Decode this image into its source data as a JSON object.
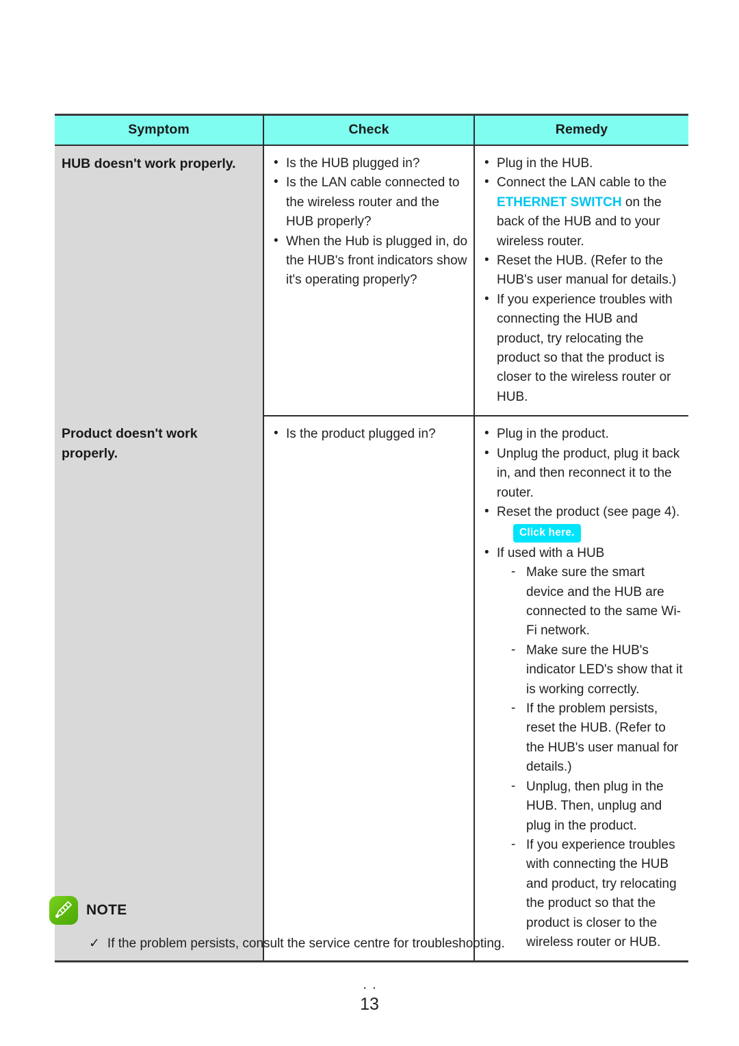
{
  "table": {
    "columns": [
      "Symptom",
      "Check",
      "Remedy"
    ],
    "rows": [
      {
        "symptom": "HUB doesn't work properly.",
        "check": [
          "Is the HUB plugged in?",
          "Is the LAN cable connected to the wireless router and the HUB properly?",
          "When the Hub is plugged in, do the HUB's front indicators show it's operating properly?"
        ],
        "remedy": [
          {
            "text": "Plug in the HUB."
          },
          {
            "pre": "Connect the LAN cable to the ",
            "highlight": "ETHERNET SWITCH",
            "post": " on the back of the HUB and to your wireless router."
          },
          {
            "text": "Reset the HUB. (Refer to the HUB's user manual for details.)"
          },
          {
            "text": "If you experience troubles with connecting the HUB and product, try relocating the product so that the product is closer to the wireless router or HUB."
          }
        ]
      },
      {
        "symptom": "Product doesn't work properly.",
        "check": [
          "Is the product plugged in?"
        ],
        "remedy": [
          {
            "text": "Plug in the product."
          },
          {
            "text": "Unplug the product, plug it back in, and then reconnect it to the router."
          },
          {
            "text": "Reset the product (see page 4).",
            "badge": "Click here."
          },
          {
            "text": "If used with a HUB",
            "sub": [
              "Make sure the smart device and the HUB are connected to the same Wi-Fi network.",
              "Make sure the HUB's indicator LED's show that it is working correctly.",
              "If the problem persists, reset the HUB. (Refer to the HUB's user manual for details.)",
              "Unplug, then plug in the HUB. Then, unplug and plug in the product.",
              "If you experience troubles with connecting the HUB and product, try relocating the product so that the product is closer to the wireless router or HUB."
            ]
          }
        ]
      }
    ]
  },
  "note": {
    "title": "NOTE",
    "check_symbol": "✓",
    "items": [
      "If the problem persists, consult the service centre for troubleshooting."
    ]
  },
  "footer": {
    "dots": "··",
    "page_number": "13"
  },
  "colors": {
    "header_cyan": "#7ffdf1",
    "symptom_grey": "#d9d9d9",
    "keyword_cyan": "#00c4f0",
    "badge_cyan": "#00e4fb",
    "note_green": "#5cb80c",
    "text": "#231f20"
  }
}
